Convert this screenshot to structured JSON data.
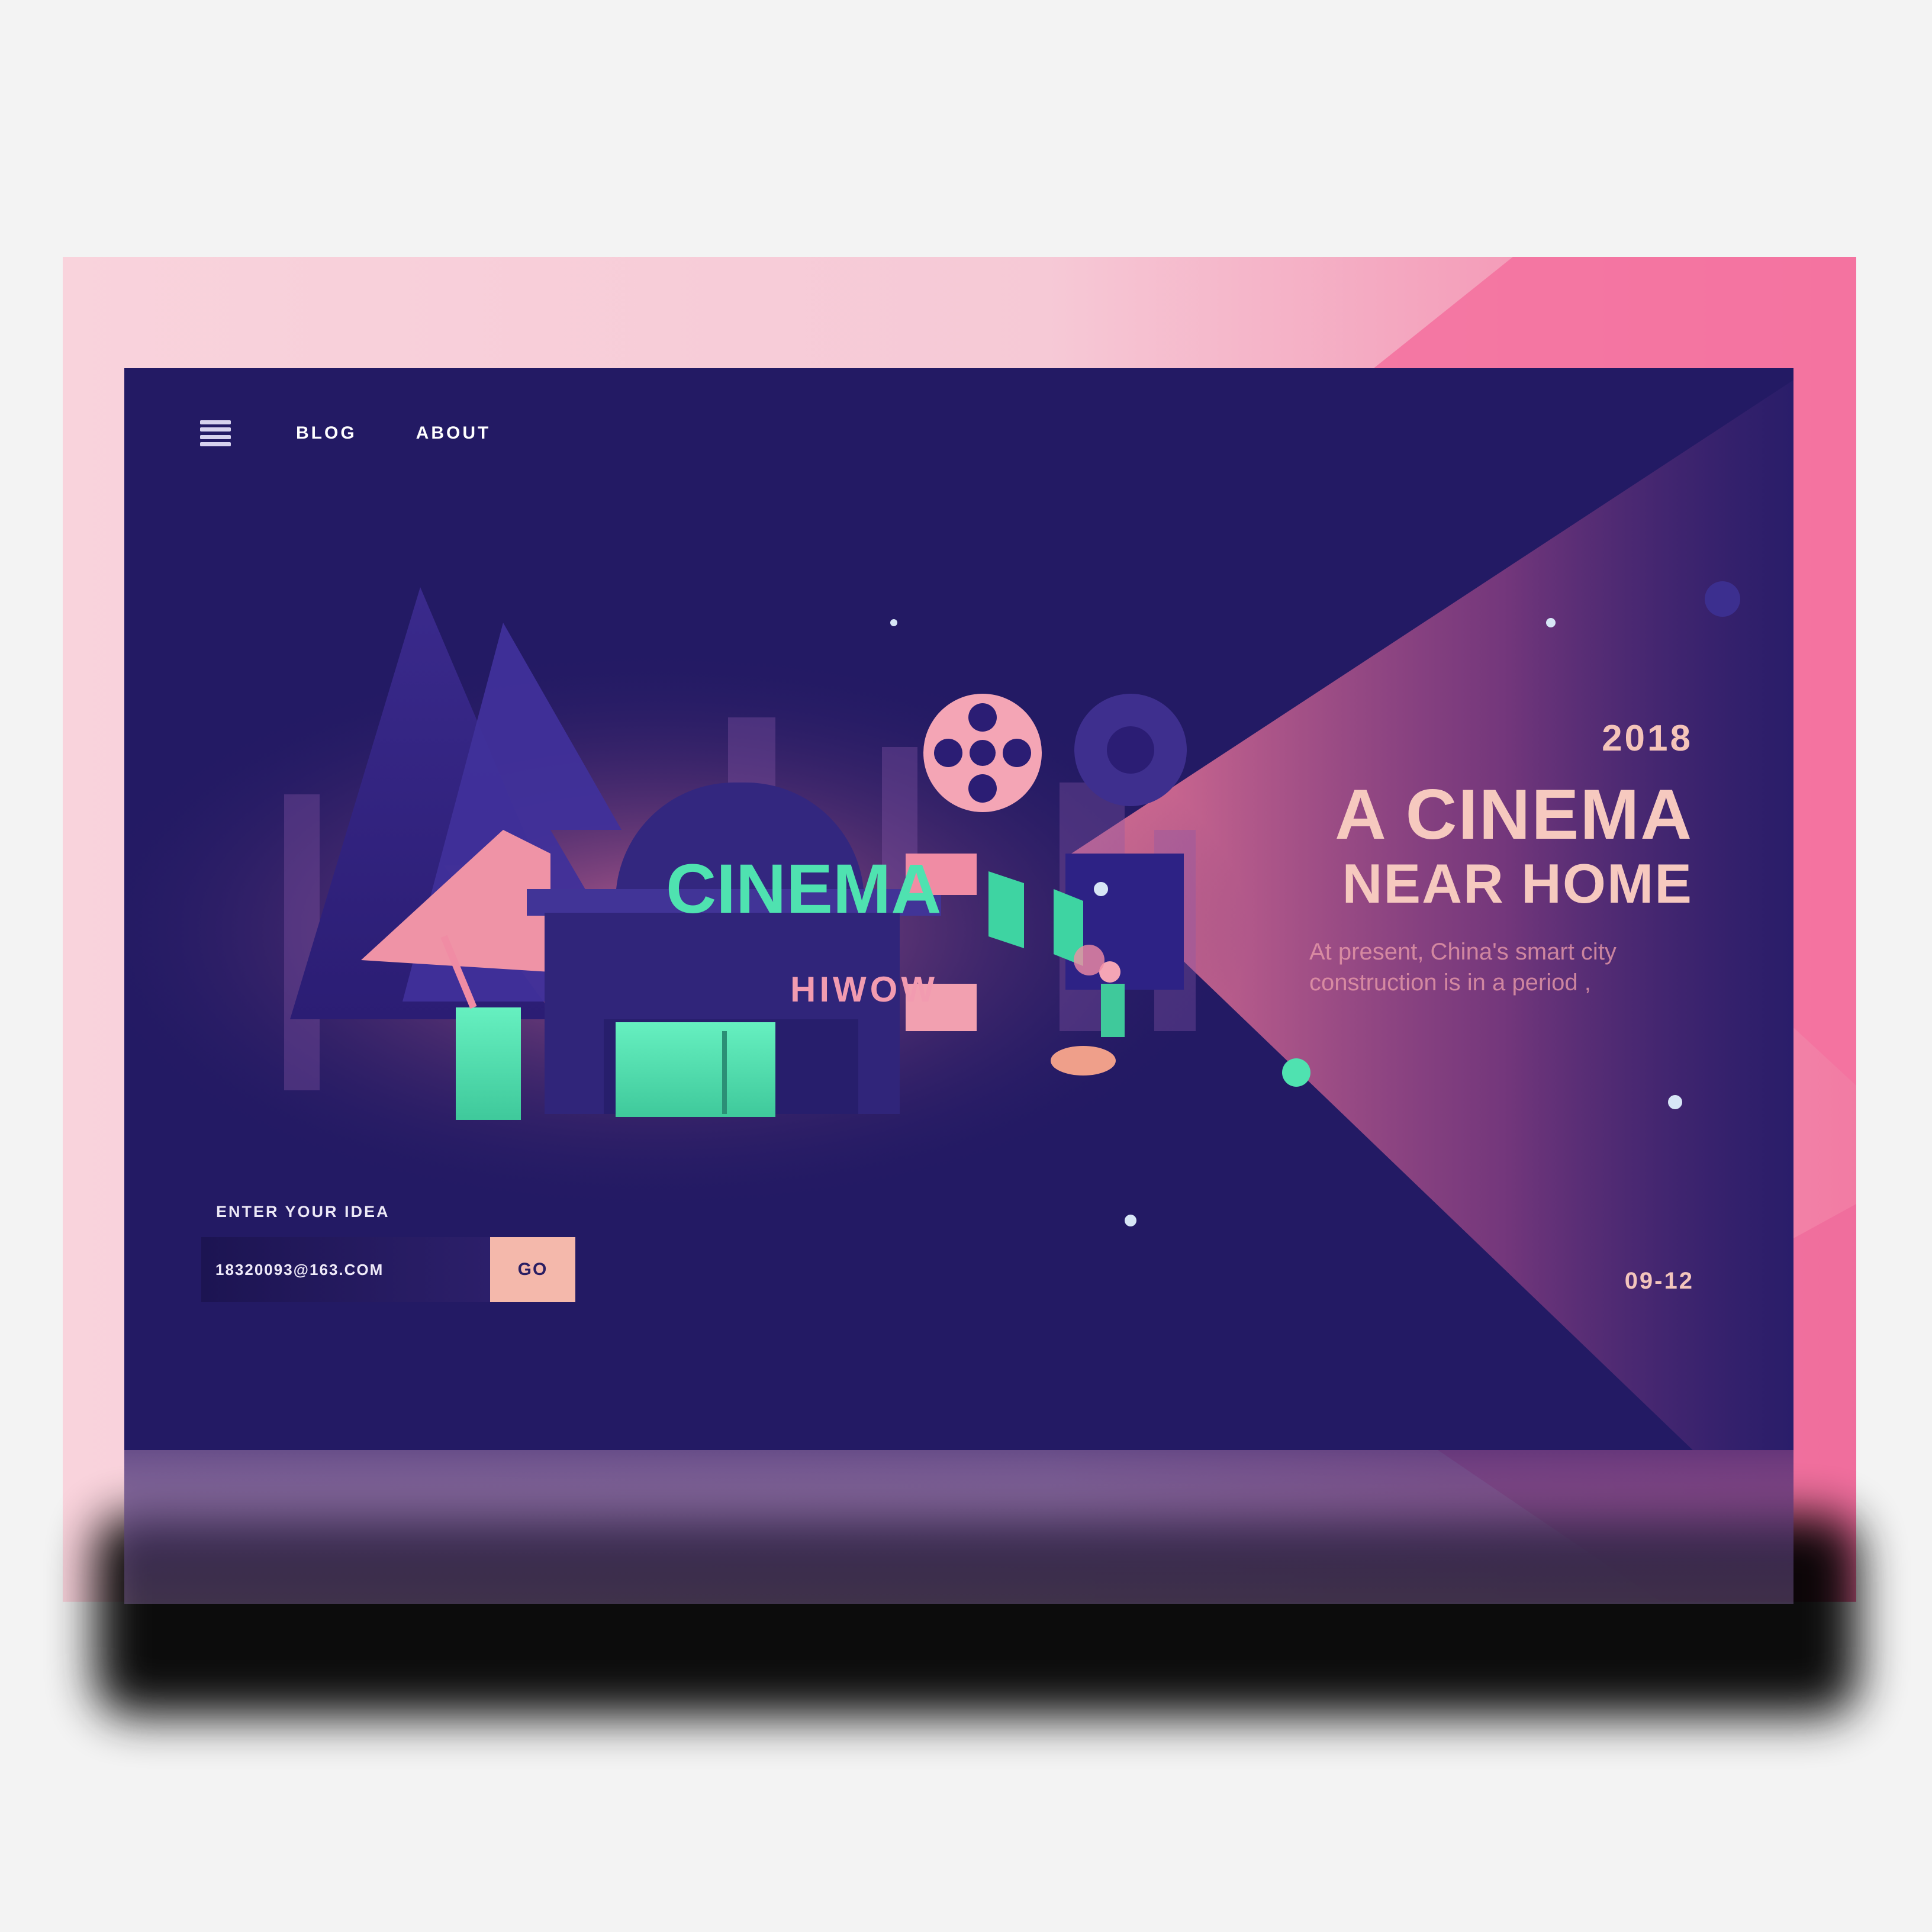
{
  "nav": {
    "blog_label": "BLOG",
    "about_label": "ABOUT"
  },
  "illustration": {
    "sign_text": "CINEMA",
    "storefront_text": "HIWOW"
  },
  "hero": {
    "year": "2018",
    "title_line1": "A CINEMA",
    "title_line2": "NEAR HOME",
    "subtitle_line1": "At present, China's smart city",
    "subtitle_line2": "construction is in a period ,"
  },
  "form": {
    "label": "ENTER YOUR IDEA",
    "input_value": "18320093@163.COM",
    "go_label": "GO"
  },
  "date": "09-12",
  "colors": {
    "screen_bg": "#231a64",
    "accent_mint": "#4fe2b0",
    "accent_pink": "#f27ba3",
    "accent_peach": "#f4b8ab"
  }
}
